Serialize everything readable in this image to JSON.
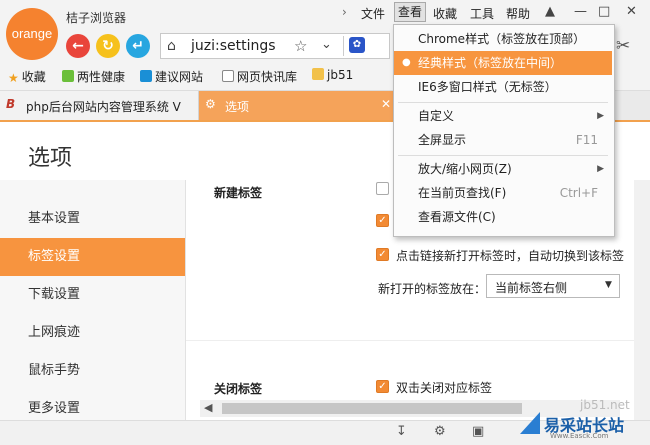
{
  "app": {
    "logo_text": "orange",
    "title": "桔子浏览器"
  },
  "address": {
    "url": "juzi:settings"
  },
  "menubar": [
    "文件",
    "查看",
    "收藏",
    "工具",
    "帮助"
  ],
  "bookmarks": [
    "收藏",
    "两性健康",
    "建议网站",
    "网页快讯库",
    "jb51"
  ],
  "tabs": [
    {
      "label": "php后台网站内容管理系统 V"
    },
    {
      "label": "选项"
    }
  ],
  "page": {
    "title": "选项"
  },
  "sidebar": [
    "基本设置",
    "标签设置",
    "下载设置",
    "上网痕迹",
    "鼠标手势",
    "更多设置"
  ],
  "content": {
    "new_tab_heading": "新建标签",
    "option_auto_switch": "点击链接新打开标签时，自动切换到该标签",
    "new_tab_position_label": "新打开的标签放在：",
    "new_tab_position_value": "当前标签右侧",
    "close_tab_heading": "关闭标签",
    "option_dblclick_close": "双击关闭对应标签"
  },
  "view_menu": {
    "items": [
      {
        "label": "Chrome样式（标签放在顶部）",
        "selected": false
      },
      {
        "label": "经典样式（标签放在中间）",
        "selected": true
      },
      {
        "label": "IE6多窗口样式（无标签）",
        "selected": false
      },
      {
        "label": "自定义",
        "submenu": true
      },
      {
        "label": "全屏显示",
        "shortcut": "F11"
      },
      {
        "label": "放大/缩小网页(Z)",
        "submenu": true
      },
      {
        "label": "在当前页查找(F)",
        "shortcut": "Ctrl+F"
      },
      {
        "label": "查看源文件(C)"
      }
    ]
  },
  "watermark": {
    "site": "jb51.net",
    "brand": "易采站长站",
    "url": "Www.Easck.Com"
  },
  "colors": {
    "accent": "#f7943f",
    "titlebar": "#f3f3f3"
  }
}
